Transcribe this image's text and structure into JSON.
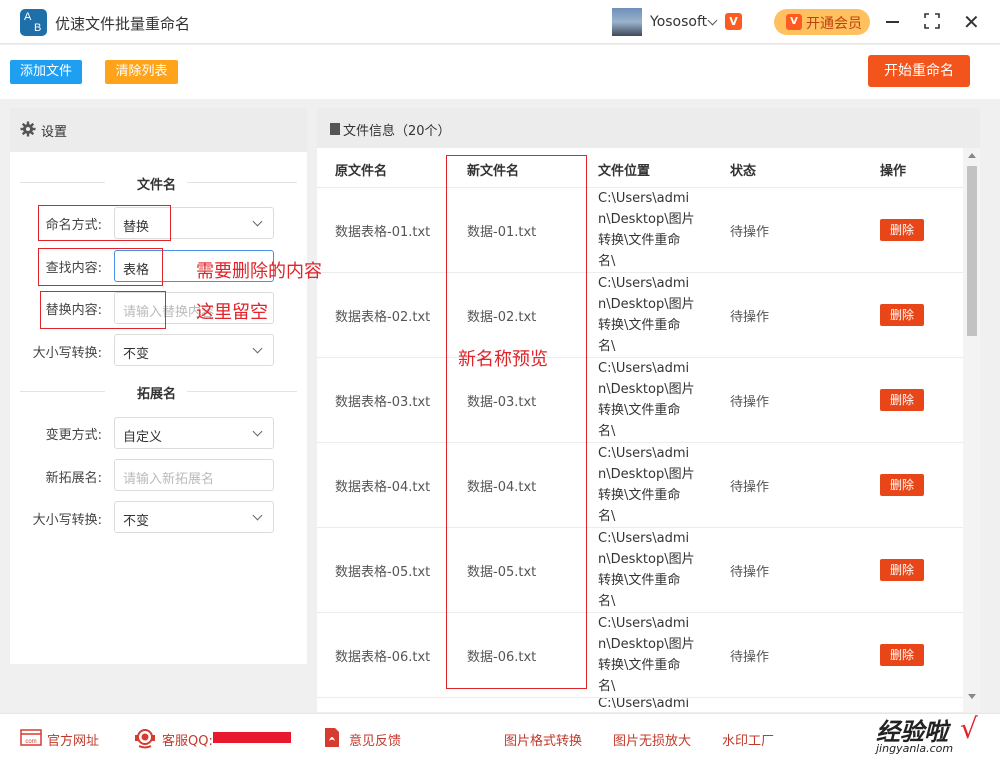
{
  "app": {
    "title": "优速文件批量重命名",
    "logo_letters": [
      "A",
      "B"
    ],
    "username": "Yososoft",
    "vip_label": "开通会员"
  },
  "toolbar": {
    "add_label": "添加文件",
    "clear_label": "清除列表",
    "start_label": "开始重命名"
  },
  "settings": {
    "title": "设置",
    "filename_section": "文件名",
    "mode_label": "命名方式:",
    "mode_value": "替换",
    "find_label": "查找内容:",
    "find_value": "表格",
    "replace_label": "替换内容:",
    "replace_placeholder": "请输入替换内容",
    "case_label": "大小写转换:",
    "case_value": "不变",
    "ext_section": "拓展名",
    "ext_mode_label": "变更方式:",
    "ext_mode_value": "自定义",
    "new_ext_label": "新拓展名:",
    "new_ext_placeholder": "请输入新拓展名",
    "ext_case_label": "大小写转换:",
    "ext_case_value": "不变"
  },
  "files": {
    "title": "文件信息（20个）",
    "columns": [
      "原文件名",
      "新文件名",
      "文件位置",
      "状态",
      "操作"
    ],
    "rows": [
      {
        "original": "数据表格-01.txt",
        "new_name": "数据-01.txt",
        "location_lines": [
          "C:\\Users\\admi",
          "n\\Desktop\\图片",
          "转换\\文件重命",
          "名\\"
        ],
        "status": "待操作",
        "action": "删除"
      },
      {
        "original": "数据表格-02.txt",
        "new_name": "数据-02.txt",
        "location_lines": [
          "C:\\Users\\admi",
          "n\\Desktop\\图片",
          "转换\\文件重命",
          "名\\"
        ],
        "status": "待操作",
        "action": "删除"
      },
      {
        "original": "数据表格-03.txt",
        "new_name": "数据-03.txt",
        "location_lines": [
          "C:\\Users\\admi",
          "n\\Desktop\\图片",
          "转换\\文件重命",
          "名\\"
        ],
        "status": "待操作",
        "action": "删除"
      },
      {
        "original": "数据表格-04.txt",
        "new_name": "数据-04.txt",
        "location_lines": [
          "C:\\Users\\admi",
          "n\\Desktop\\图片",
          "转换\\文件重命",
          "名\\"
        ],
        "status": "待操作",
        "action": "删除"
      },
      {
        "original": "数据表格-05.txt",
        "new_name": "数据-05.txt",
        "location_lines": [
          "C:\\Users\\admi",
          "n\\Desktop\\图片",
          "转换\\文件重命",
          "名\\"
        ],
        "status": "待操作",
        "action": "删除"
      },
      {
        "original": "数据表格-06.txt",
        "new_name": "数据-06.txt",
        "location_lines": [
          "C:\\Users\\admi",
          "n\\Desktop\\图片",
          "转换\\文件重命",
          "名\\"
        ],
        "status": "待操作",
        "action": "删除"
      }
    ],
    "partial_row_location": "C:\\Users\\admi"
  },
  "annotations": {
    "find_note": "需要删除的内容",
    "replace_note": "这里留空",
    "preview_note": "新名称预览"
  },
  "footer": {
    "website": "官方网址",
    "qq": "客服QQ:",
    "feedback": "意见反馈",
    "link1": "图片格式转换",
    "link2": "图片无损放大",
    "link3": "水印工厂"
  },
  "watermark": {
    "main": "经验啦",
    "sub": "jingyanla.com",
    "check": "√"
  },
  "colors": {
    "primary_blue": "#1e9ff2",
    "clear_orange": "#ffa31a",
    "start_red": "#f2541b",
    "delete_red": "#e84618",
    "annotation_red": "#e0242a"
  }
}
